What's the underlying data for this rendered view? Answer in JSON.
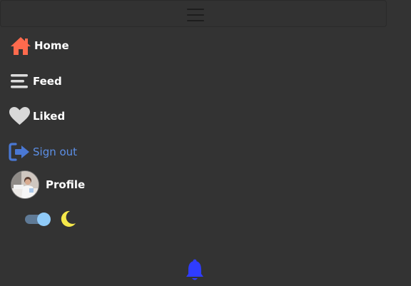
{
  "header": {
    "menu_icon": "hamburger-menu-icon"
  },
  "nav": {
    "items": [
      {
        "label": "Home",
        "icon": "home-icon",
        "color": "#ff6a4d"
      },
      {
        "label": "Feed",
        "icon": "feed-lines-icon",
        "color": "#dcdcdc"
      },
      {
        "label": "Liked",
        "icon": "heart-icon",
        "color": "#d8d8d8"
      },
      {
        "label": "Sign out",
        "icon": "sign-out-icon",
        "color": "#4a78d4"
      },
      {
        "label": "Profile",
        "icon": "avatar"
      }
    ]
  },
  "theme": {
    "dark_mode_enabled": true,
    "moon_icon": "moon-icon",
    "moon_color": "#f5e84a"
  },
  "notifications": {
    "icon": "bell-icon",
    "color": "#2f3cff"
  },
  "colors": {
    "background": "#333333",
    "text": "#ffffff",
    "accent_link": "#5c8fe6"
  }
}
